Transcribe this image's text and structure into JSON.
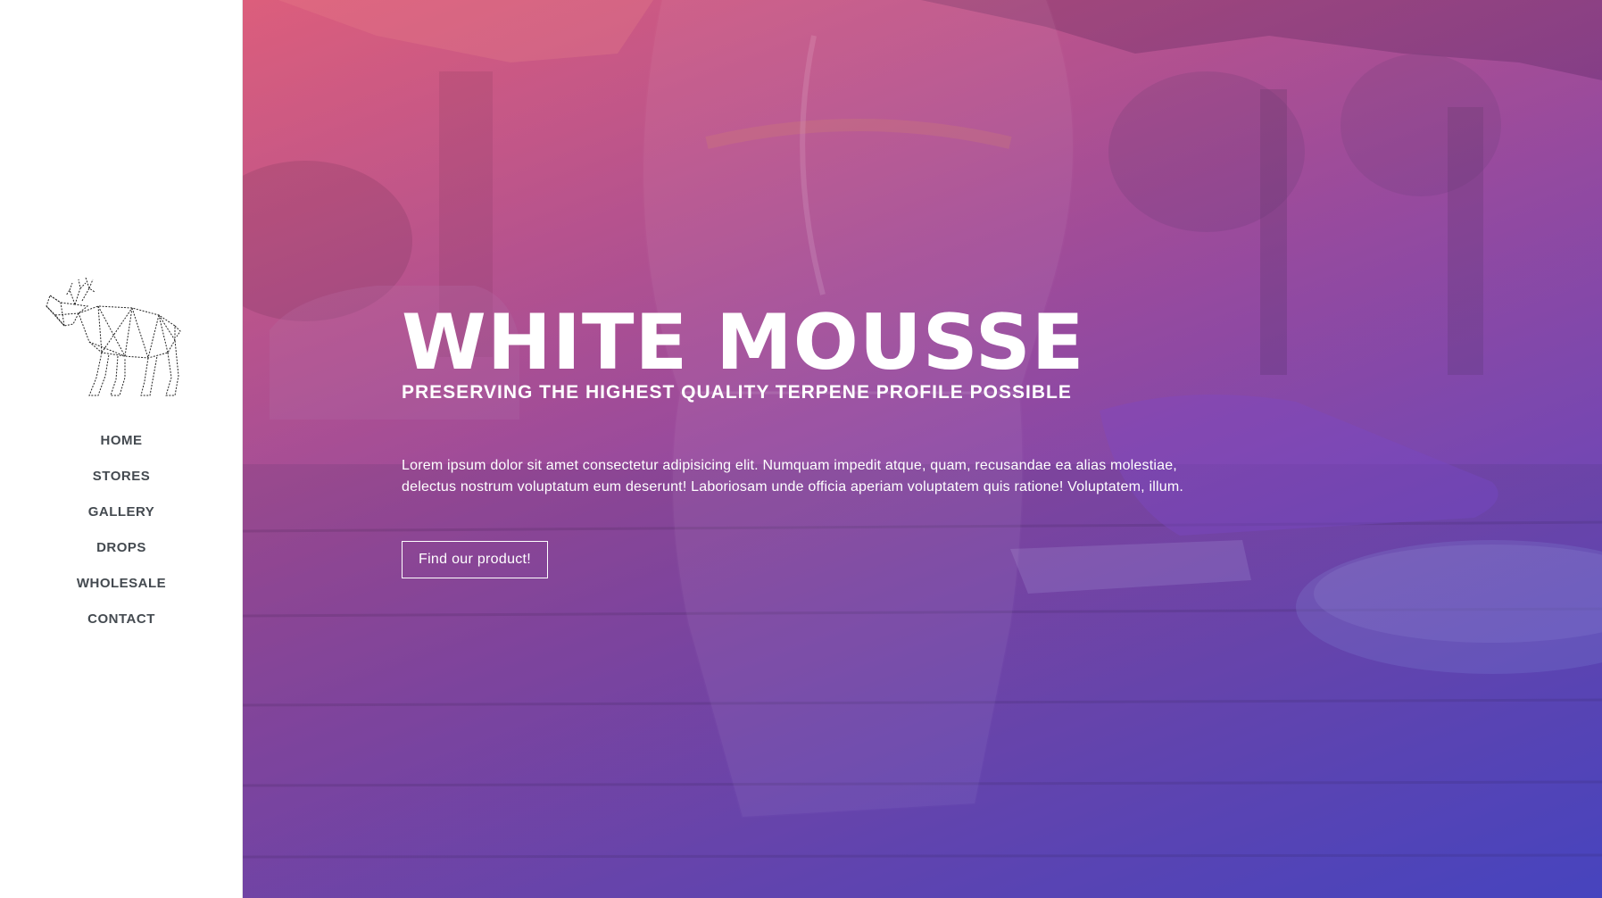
{
  "nav": {
    "items": [
      {
        "label": "HOME"
      },
      {
        "label": "STORES"
      },
      {
        "label": "GALLERY"
      },
      {
        "label": "DROPS"
      },
      {
        "label": "WHOLESALE"
      },
      {
        "label": "CONTACT"
      }
    ]
  },
  "logo": {
    "icon": "moose-icon"
  },
  "hero": {
    "title": "WHITE MOUSSE",
    "subtitle": "PRESERVING THE HIGHEST QUALITY TERPENE PROFILE POSSIBLE",
    "body": "Lorem ipsum dolor sit amet consectetur adipisicing elit. Numquam impedit atque, quam, recusandae ea alias molestiae, delectus nostrum voluptatum eum deserunt! Laboriosam unde officia aperiam voluptatem quis ratione! Voluptatem, illum.",
    "cta_label": "Find our product!"
  },
  "colors": {
    "gradient_start": "#d9637e",
    "gradient_mid": "#7c48ad",
    "gradient_end": "#4b48c7",
    "nav_text": "#444a50",
    "hero_text": "#ffffff"
  }
}
